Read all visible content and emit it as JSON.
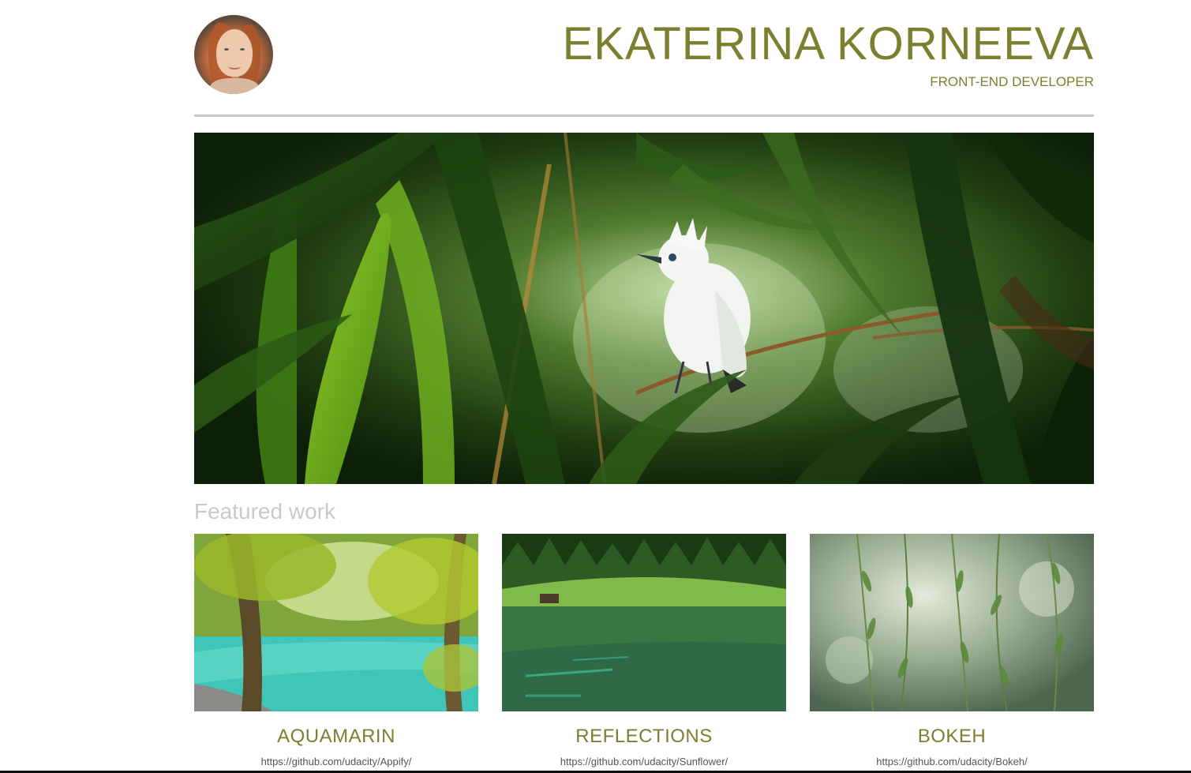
{
  "header": {
    "name": "EKATERINA KORNEEVA",
    "role": "FRONT-END DEVELOPER"
  },
  "featured": {
    "title": "Featured work",
    "items": [
      {
        "title": "AQUAMARIN",
        "link": "https://github.com/udacity/Appify/"
      },
      {
        "title": "REFLECTIONS",
        "link": "https://github.com/udacity/Sunflower/"
      },
      {
        "title": "BOKEH",
        "link": "https://github.com/udacity/Bokeh/"
      }
    ]
  },
  "colors": {
    "accent": "#7c7f2f",
    "divider": "#c8c8c8",
    "muted_heading": "#c9c9c9"
  }
}
